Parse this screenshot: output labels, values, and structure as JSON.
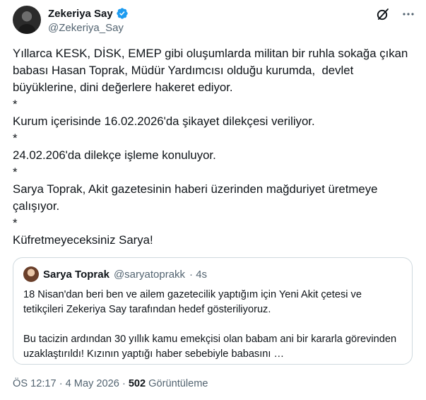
{
  "author": {
    "display_name": "Zekeriya Say",
    "handle": "@Zekeriya_Say"
  },
  "icons": {
    "verified": "verified-badge-icon",
    "grok": "grok-icon",
    "more": "more-icon"
  },
  "colors": {
    "verified": "#1d9bf0",
    "text": "#0f1419",
    "secondary": "#536471",
    "border": "#cfd9de"
  },
  "tweet": {
    "lines": [
      "Yıllarca KESK, DİSK, EMEP gibi oluşumlarda militan bir ruhla sokağa çıkan babası Hasan Toprak, Müdür Yardımcısı olduğu kurumda,  devlet büyüklerine, dini değerlere hakeret ediyor.",
      "*",
      "Kurum içerisinde 16.02.2026'da şikayet dilekçesi veriliyor.",
      "*",
      "24.02.206'da dilekçe işleme konuluyor.",
      "*",
      "Sarya Toprak, Akit gazetesinin haberi üzerinden mağduriyet üretmeye çalışıyor.",
      "*",
      "Küfretmeyeceksiniz Sarya!"
    ]
  },
  "quote": {
    "display_name": "Sarya Toprak",
    "handle": "@saryatoprakk",
    "time": "· 4s",
    "paragraph1": "18 Nisan'dan beri ben ve ailem gazetecilik yaptığım için Yeni Akit çetesi ve tetikçileri Zekeriya Say tarafından hedef gösteriliyoruz.",
    "paragraph2": "Bu tacizin ardından 30 yıllık kamu emekçisi olan babam ani bir kararla görevinden uzaklaştırıldı! Kızının yaptığı haber sebebiyle babasını …"
  },
  "meta": {
    "timestamp": "ÖS 12:17 · 4 May 2026 ·",
    "views_count": "502",
    "views_label": "Görüntüleme"
  }
}
